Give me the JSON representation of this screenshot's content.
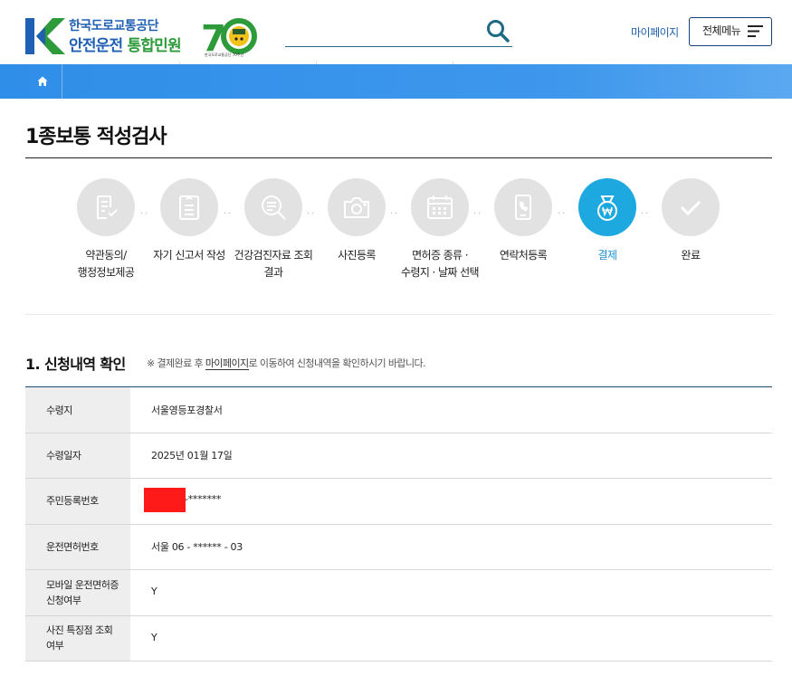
{
  "header": {
    "logo_line1": "한국도로교통공단",
    "logo_line2a": "안전운전",
    "logo_line2b": "통합민원",
    "anniv_number": "70",
    "anniv_caption": "한국도로교통공단 70주년",
    "search_placeholder": "",
    "search_value": "",
    "mypage_label": "마이페이지",
    "allmenu_label": "전체메뉴"
  },
  "page": {
    "title": "1종보통 적성검사"
  },
  "steps": [
    {
      "label": "약관동의/\n행정정보제공",
      "icon": "document-check-icon",
      "active": false
    },
    {
      "label": "자기 신고서 작성",
      "icon": "form-icon",
      "active": false
    },
    {
      "label": "건강검진자료 조회\n결과",
      "icon": "search-document-icon",
      "active": false
    },
    {
      "label": "사진등록",
      "icon": "camera-icon",
      "active": false
    },
    {
      "label": "면허증 종류 ·\n수령지 · 날짜 선택",
      "icon": "calendar-icon",
      "active": false
    },
    {
      "label": "연락처등록",
      "icon": "phone-icon",
      "active": false
    },
    {
      "label": "결제",
      "icon": "payment-won-icon",
      "active": true
    },
    {
      "label": "완료",
      "icon": "check-icon",
      "active": false
    }
  ],
  "section": {
    "title": "1. 신청내역 확인",
    "note_prefix": "※ 결제완료 후 ",
    "note_link": "마이페이지",
    "note_suffix": "로 이동하여 신청내역을 확인하시기 바랍니다."
  },
  "table": {
    "rows": [
      {
        "label": "수령지",
        "value": "서울영등포경찰서"
      },
      {
        "label": "수령일자",
        "value": "2025년 01월 17일"
      },
      {
        "label": "주민등록번호",
        "value": "-*******"
      },
      {
        "label": "운전면허번호",
        "value": "서울 06 - ****** - 03"
      },
      {
        "label": "모바일 운전면허증\n신청여부",
        "value": "Y"
      },
      {
        "label": "사진 특징점 조회\n여부",
        "value": "Y"
      }
    ]
  },
  "colors": {
    "brand_blue": "#1f5fb4",
    "brand_green": "#2e9b3a",
    "nav_blue": "#2f8ee8",
    "active_step": "#1da9e0",
    "redaction": "#ff1a1a"
  }
}
